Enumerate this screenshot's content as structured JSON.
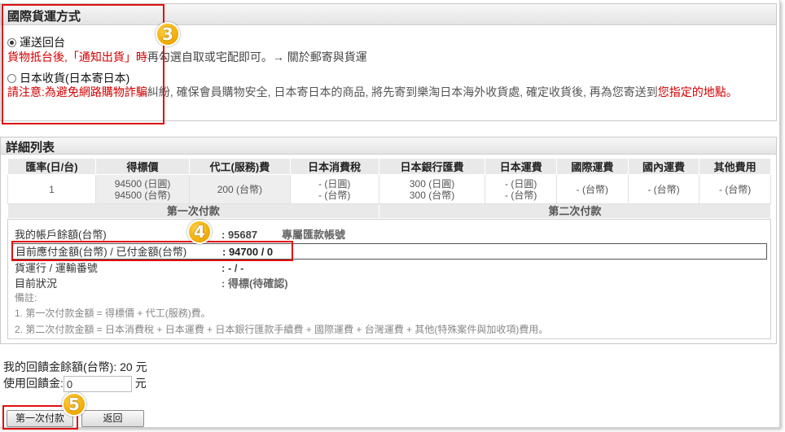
{
  "shipping": {
    "header": "國際貨運方式",
    "option1_label": "運送回台",
    "option1_note_red": "貨物抵台後,「通知出貨」時",
    "option1_note": "再勾選自取或宅配即可。→ 關於郵寄與貨運",
    "option2_label": "日本收貨(日本寄日本)",
    "option2_note_red1": "請注意:為避免網路購物詐騙",
    "option2_note": "糾紛, 確保會員購物安全, 日本寄日本的商品, 將先寄到樂淘日本海外收貨處, 確定收貨後, 再為您寄送到",
    "option2_note_red2": "您指定的地點。",
    "badge": "3"
  },
  "detail": {
    "header": "詳細列表",
    "columns": [
      "匯率(日/台)",
      "得標價",
      "代工(服務)費",
      "日本消費稅",
      "日本銀行匯費",
      "日本運費",
      "國際運費",
      "國內運費",
      "其他費用"
    ],
    "row": [
      [
        "1"
      ],
      [
        "94500 (日圓)",
        "94500 (台幣)"
      ],
      [
        "200 (台幣)"
      ],
      [
        "- (日圓)",
        "- (台幣)"
      ],
      [
        "300 (日圓)",
        "300 (台幣)"
      ],
      [
        "- (日圓)",
        "- (台幣)"
      ],
      [
        "- (台幣)"
      ],
      [
        "- (台幣)"
      ],
      [
        "- (台幣)"
      ]
    ],
    "first_payment": "第一次付款",
    "second_payment": "第二次付款",
    "badge": "4",
    "info": {
      "balance_label": "我的帳戶餘額(台幣)",
      "balance_value": ": 95687",
      "account_link": "專屬匯款帳號",
      "due_label": "目前應付金額(台幣) / 已付金額(台幣)",
      "due_value": ": 94700 / 0",
      "carrier_label": "貨運行 / 運輸番號",
      "carrier_value": ": - / -",
      "status_label": "目前狀況",
      "status_value": ": 得標(待確認)",
      "remark_title": "備註:",
      "remark1": "1. 第一次付款金額 = 得標價 + 代工(服務)費。",
      "remark2": "2. 第二次付款金額 = 日本消費稅 + 日本運費 + 日本銀行匯款手續費 + 國際運費 + 台灣運費 + 其他(特殊案件與加收項)費用。"
    }
  },
  "bottom": {
    "rebate_balance": "我的回饋金餘額(台幣): 20 元",
    "use_rebate_label": "使用回饋金:",
    "use_rebate_value": "0",
    "currency_unit": "元",
    "pay_button": "第一次付款",
    "back_button": "返回",
    "badge": "5"
  },
  "colors": {
    "highlight_red": "#e01010",
    "badge_gold": "#f0a800",
    "header_bg": "#e4e4e4"
  }
}
